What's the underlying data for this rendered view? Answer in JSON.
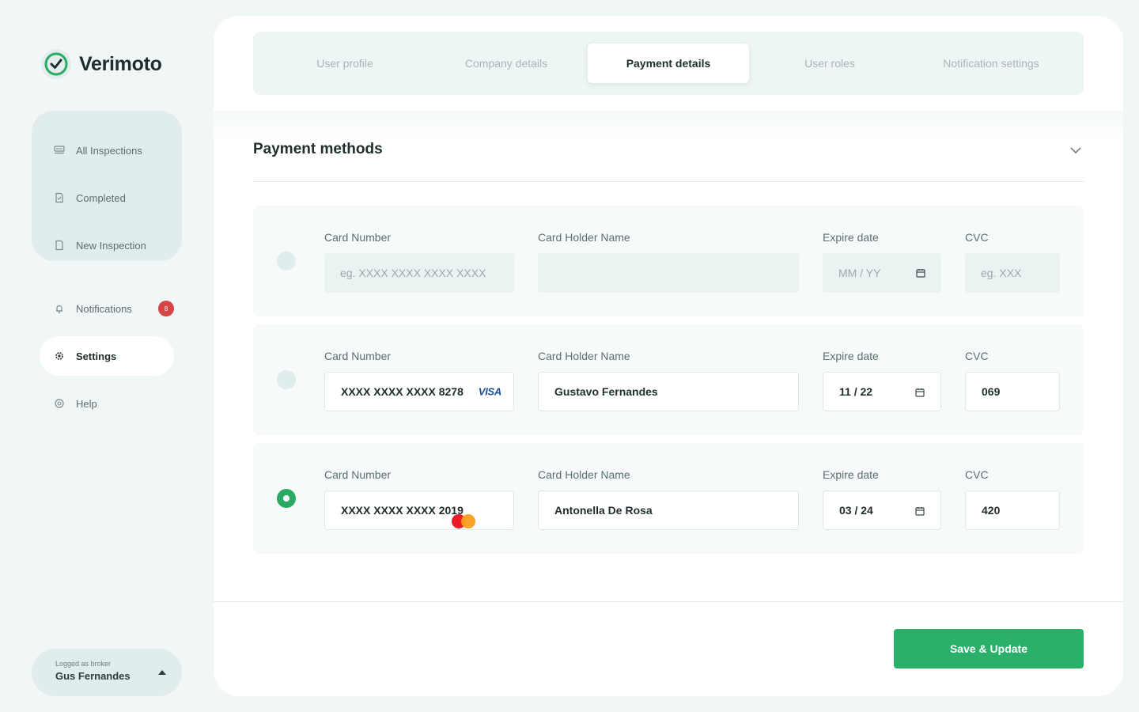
{
  "app": {
    "name": "Verimoto"
  },
  "sidebar": {
    "group_items": [
      {
        "label": "All Inspections",
        "icon": "inbox-icon"
      },
      {
        "label": "Completed",
        "icon": "document-check-icon"
      },
      {
        "label": "New Inspection",
        "icon": "document-icon"
      }
    ],
    "notifications": {
      "label": "Notifications",
      "count": "8"
    },
    "settings": {
      "label": "Settings"
    },
    "help": {
      "label": "Help"
    }
  },
  "user": {
    "role": "Logged as broker",
    "name": "Gus Fernandes"
  },
  "tabs": [
    {
      "label": "User profile",
      "active": false
    },
    {
      "label": "Company details",
      "active": false
    },
    {
      "label": "Payment details",
      "active": true
    },
    {
      "label": "User roles",
      "active": false
    },
    {
      "label": "Notification settings",
      "active": false
    }
  ],
  "section": {
    "title": "Payment methods"
  },
  "labels": {
    "card_number": "Card Number",
    "holder_name": "Card Holder Name",
    "expire": "Expire date",
    "cvc": "CVC"
  },
  "cards": [
    {
      "selected": false,
      "card_number": "",
      "card_number_placeholder": "eg. XXXX XXXX XXXX XXXX",
      "holder_name": "",
      "expire": "",
      "expire_placeholder": "MM / YY",
      "cvc": "",
      "cvc_placeholder": "eg. XXX",
      "brand": ""
    },
    {
      "selected": false,
      "card_number": "XXXX XXXX XXXX 8278",
      "holder_name": "Gustavo Fernandes",
      "expire": "11 / 22",
      "cvc": "069",
      "brand": "VISA"
    },
    {
      "selected": true,
      "card_number": "XXXX XXXX XXXX 2019",
      "holder_name": "Antonella De Rosa",
      "expire": "03 / 24",
      "cvc": "420",
      "brand": "mastercard"
    }
  ],
  "actions": {
    "save_label": "Save & Update"
  },
  "colors": {
    "accent": "#2bb069",
    "badge": "#d64545",
    "visa": "#1a4fa3"
  }
}
